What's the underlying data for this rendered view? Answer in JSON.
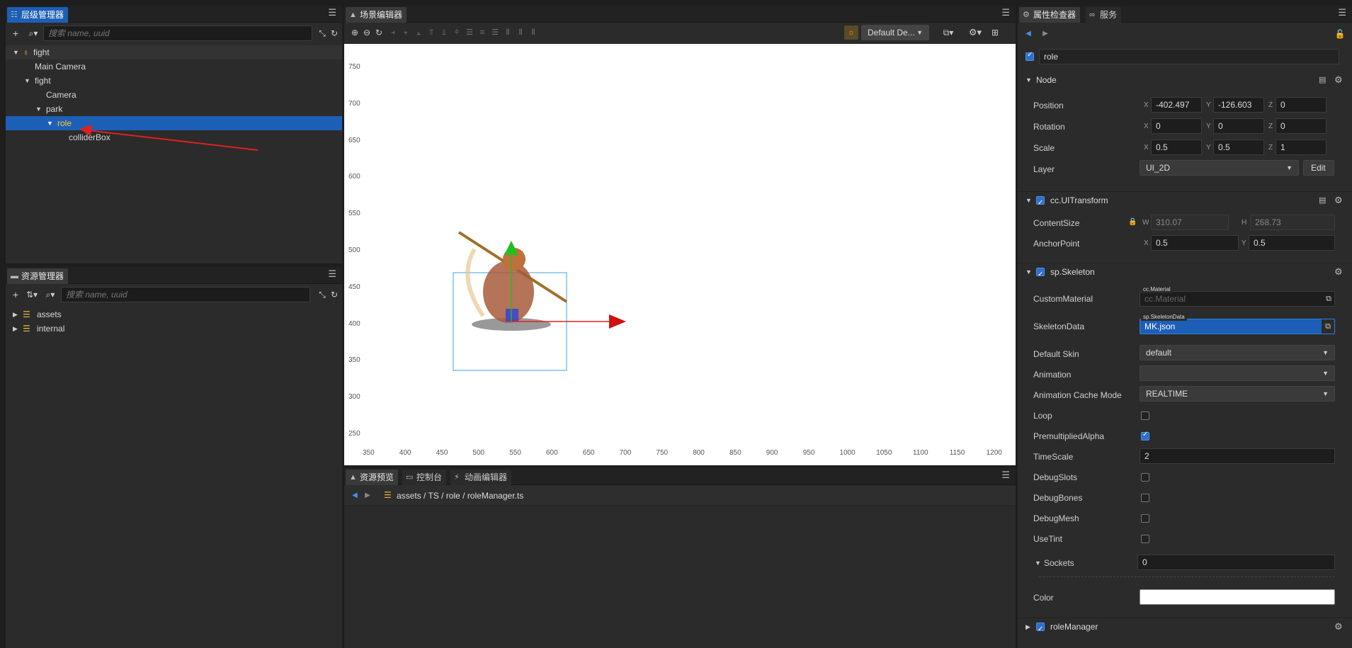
{
  "hierarchy": {
    "tab": "层级管理器",
    "search_placeholder": "搜索 name, uuid",
    "nodes": [
      {
        "label": "fight",
        "depth": 0
      },
      {
        "label": "Main Camera",
        "depth": 1
      },
      {
        "label": "fight",
        "depth": 1
      },
      {
        "label": "Camera",
        "depth": 2
      },
      {
        "label": "park",
        "depth": 2
      },
      {
        "label": "role",
        "depth": 3
      },
      {
        "label": "colliderBox",
        "depth": 4
      }
    ]
  },
  "assets": {
    "tab": "资源管理器",
    "search_placeholder": "搜索 name, uuid",
    "items": [
      "assets",
      "internal"
    ]
  },
  "scene": {
    "tab": "场景编辑器",
    "design_dropdown": "Default De...",
    "y_ticks": [
      "750",
      "700",
      "650",
      "600",
      "550",
      "500",
      "450",
      "400",
      "350",
      "300",
      "250"
    ],
    "x_ticks": [
      "350",
      "400",
      "450",
      "500",
      "550",
      "600",
      "650",
      "700",
      "750",
      "800",
      "850",
      "900",
      "950",
      "1000",
      "1050",
      "1100",
      "1150",
      "1200"
    ]
  },
  "bottom": {
    "tabs": [
      "资源预览",
      "控制台",
      "动画编辑器"
    ],
    "path": "assets / TS / role / roleManager.ts"
  },
  "inspector": {
    "tabs": [
      "属性检查器",
      "服务"
    ],
    "node_name": "role",
    "node_section": "Node",
    "position_label": "Position",
    "position": {
      "x": "-402.497",
      "y": "-126.603",
      "z": "0"
    },
    "rotation_label": "Rotation",
    "rotation": {
      "x": "0",
      "y": "0",
      "z": "0"
    },
    "scale_label": "Scale",
    "scale": {
      "x": "0.5",
      "y": "0.5",
      "z": "1"
    },
    "layer_label": "Layer",
    "layer": "UI_2D",
    "edit_label": "Edit",
    "uitransform": "cc.UITransform",
    "contentsize_label": "ContentSize",
    "contentsize": {
      "w": "310.07",
      "h": "268.73"
    },
    "anchor_label": "AnchorPoint",
    "anchor": {
      "x": "0.5",
      "y": "0.5"
    },
    "skeleton": "sp.Skeleton",
    "custommaterial_label": "CustomMaterial",
    "custommaterial_tag": "cc.Material",
    "custommaterial": "cc.Material",
    "skeletondata_label": "SkeletonData",
    "skeletondata_tag": "sp.SkeletonData",
    "skeletondata": "MK.json",
    "defaultskin_label": "Default Skin",
    "defaultskin": "default",
    "animation_label": "Animation",
    "animation": "",
    "cachemode_label": "Animation Cache Mode",
    "cachemode": "REALTIME",
    "loop_label": "Loop",
    "premult_label": "PremultipliedAlpha",
    "timescale_label": "TimeScale",
    "timescale": "2",
    "debugslots_label": "DebugSlots",
    "debugbones_label": "DebugBones",
    "debugmesh_label": "DebugMesh",
    "usetint_label": "UseTint",
    "sockets_label": "Sockets",
    "sockets": "0",
    "color_label": "Color",
    "rolemanager": "roleManager",
    "axis": {
      "x": "X",
      "y": "Y",
      "z": "Z",
      "w": "W",
      "h": "H"
    }
  }
}
